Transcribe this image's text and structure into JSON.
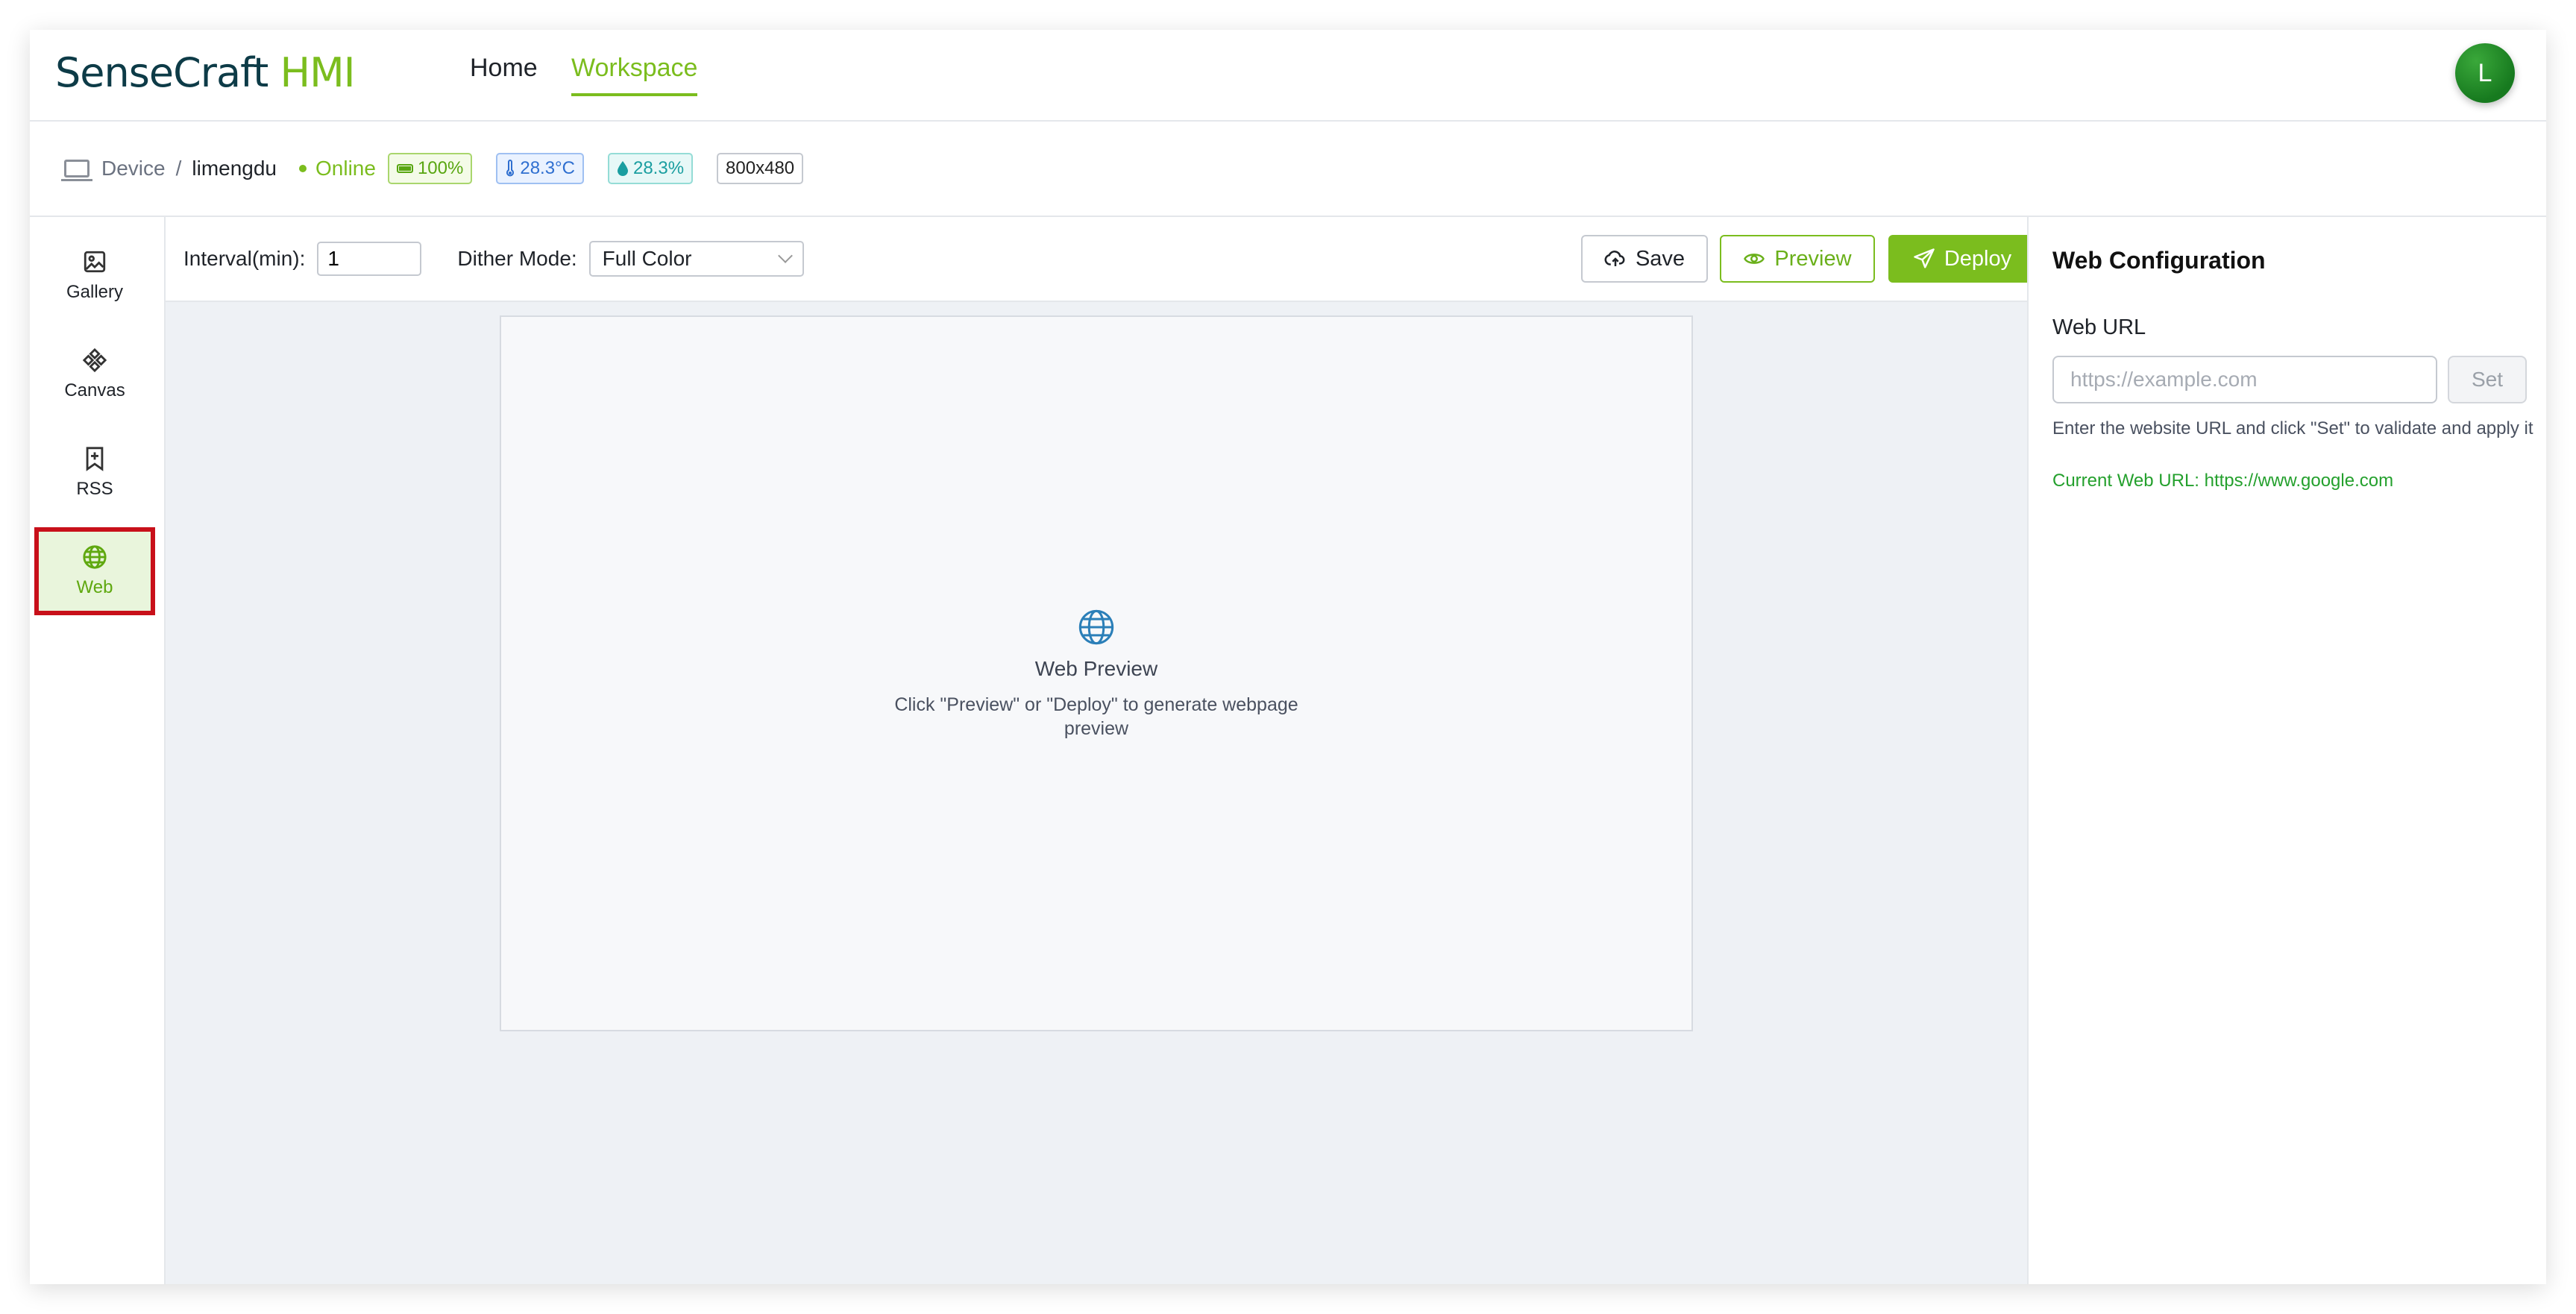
{
  "app": {
    "logo_main": "SenseCraft",
    "logo_accent": "HMI",
    "avatar_initial": "L",
    "colors": {
      "accent": "#7bbd1e",
      "highlight_border": "#c8101a"
    }
  },
  "nav": {
    "home": "Home",
    "workspace": "Workspace"
  },
  "device": {
    "breadcrumb_root": "Device",
    "separator": "/",
    "name": "limengdu",
    "status": "Online",
    "battery": "100%",
    "temperature": "28.3°C",
    "humidity": "28.3%",
    "resolution": "800x480"
  },
  "sidebar": {
    "items": [
      {
        "label": "Gallery",
        "icon": "image-icon"
      },
      {
        "label": "Canvas",
        "icon": "canvas-icon"
      },
      {
        "label": "RSS",
        "icon": "bookmark-plus-icon"
      },
      {
        "label": "Web",
        "icon": "globe-icon",
        "active": true
      }
    ]
  },
  "toolbar": {
    "interval_label": "Interval(min):",
    "interval_value": "1",
    "dither_label": "Dither Mode:",
    "dither_value": "Full Color",
    "save": "Save",
    "preview": "Preview",
    "deploy": "Deploy"
  },
  "preview": {
    "title": "Web Preview",
    "subtitle": "Click \"Preview\" or \"Deploy\" to generate webpage preview"
  },
  "web_config": {
    "title": "Web Configuration",
    "url_label": "Web URL",
    "url_placeholder": "https://example.com",
    "set_button": "Set",
    "help": "Enter the website URL and click \"Set\" to validate and apply it",
    "current_url": "Current Web URL: https://www.google.com"
  }
}
